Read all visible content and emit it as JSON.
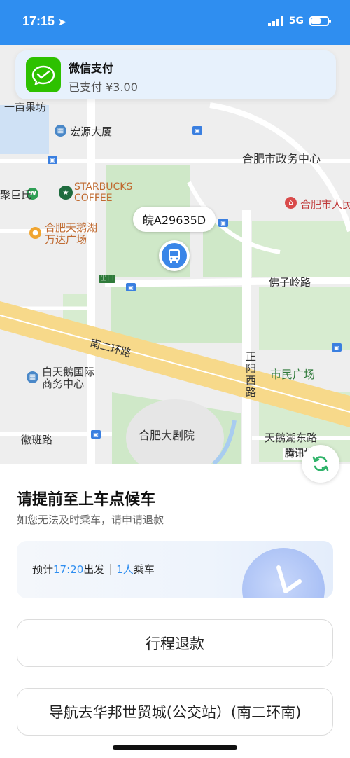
{
  "status_bar": {
    "time": "17:15",
    "network": "5G",
    "bg_color": "#2f8ef0"
  },
  "notification": {
    "app": "微信支付",
    "message": "已支付 ¥3.00",
    "icon": "wechat-pay-icon"
  },
  "map": {
    "labels": {
      "yimu": "一亩果坊",
      "hongyuan": "宏源大厦",
      "gov_center": "合肥市政务中心",
      "jubang": "聚巨氏",
      "starbucks_1": "STARBUCKS",
      "starbucks_2": "COFFEE",
      "gov_hefei": "合肥市人民",
      "wanda_1": "合肥天鹅湖",
      "wanda_2": "万达广场",
      "exit": "出口",
      "foziling": "佛子岭路",
      "nanerhuan": "南二环路",
      "baitiane_1": "白天鹅国际",
      "baitiane_2": "商务中心",
      "zhengyang_1": "正",
      "zhengyang_2": "阳",
      "zhengyang_3": "西",
      "zhengyang_4": "路",
      "shimin": "市民广场",
      "theater": "合肥大剧院",
      "huiban": "徽班路",
      "tianehu": "天鹅湖东路",
      "tencent": "腾讯地图"
    },
    "bus_plate": "皖A29635D"
  },
  "sheet": {
    "title": "请提前至上车点候车",
    "subtitle": "如您无法及时乘车，请申请退款",
    "info": {
      "prefix": "预计",
      "time": "17:20",
      "depart": "出发",
      "count": "1人",
      "board": "乘车"
    },
    "refund_button": "行程退款",
    "nav_button": "导航去华邦世贸城(公交站）(南二环南)"
  },
  "colors": {
    "accent": "#2f8ef0",
    "wechat_green": "#2dc100",
    "refresh_green": "#2fb36a"
  }
}
